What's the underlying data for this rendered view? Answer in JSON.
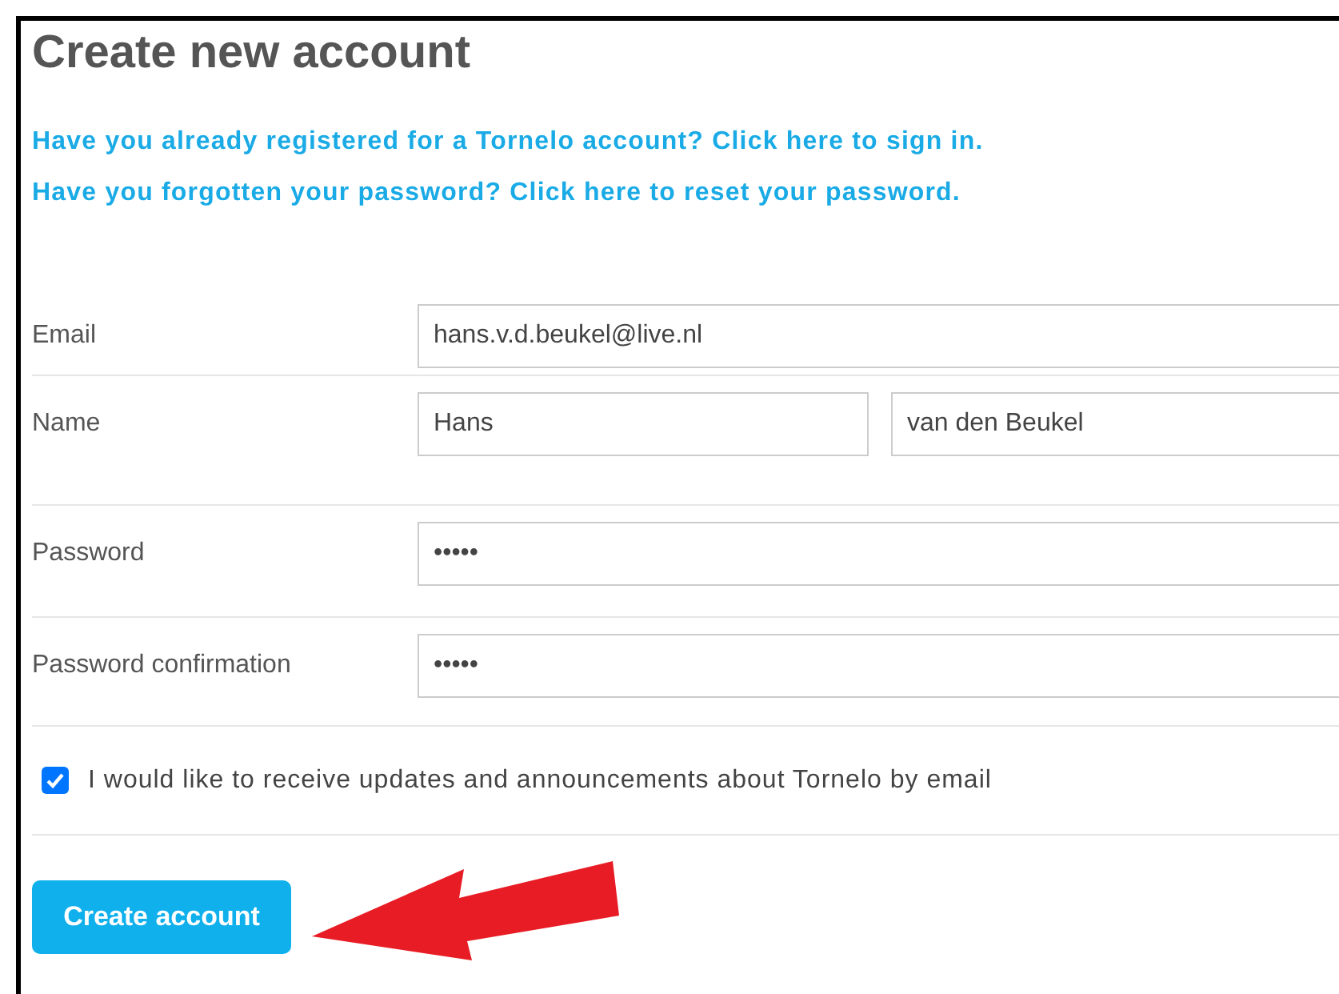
{
  "title": "Create new account",
  "links": [
    "Have you already registered for a Tornelo account? Click here to sign in.",
    "Have you forgotten your password? Click here to reset your password."
  ],
  "fields": [
    {
      "label": "Email",
      "values": [
        "hans.v.d.beukel@live.nl"
      ]
    },
    {
      "label": "Name",
      "values": [
        "Hans",
        "van den Beukel"
      ]
    },
    {
      "label": "Password",
      "values": [
        "•••••"
      ]
    },
    {
      "label": "Password confirmation",
      "values": [
        "•••••"
      ]
    }
  ],
  "updates": {
    "label": "I would like to receive updates and announcements about Tornelo by email",
    "checked": true
  },
  "submit": "Create account"
}
